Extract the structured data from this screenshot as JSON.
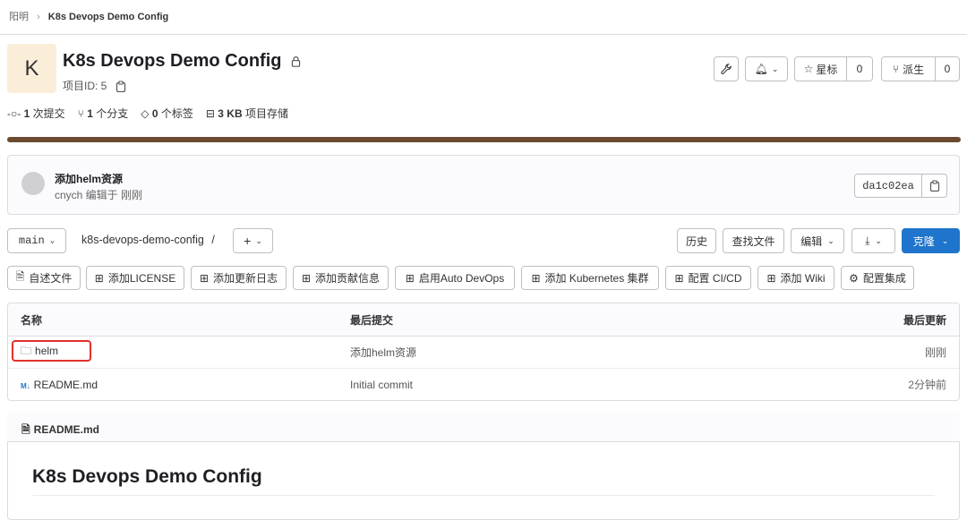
{
  "breadcrumb": {
    "parent": "阳明",
    "current": "K8s Devops Demo Config"
  },
  "project": {
    "avatar_letter": "K",
    "title": "K8s Devops Demo Config",
    "id_label": "项目ID: 5"
  },
  "header_actions": {
    "star_label": "星标",
    "star_count": "0",
    "fork_label": "派生",
    "fork_count": "0"
  },
  "stats": {
    "commits": {
      "count": "1",
      "label": "次提交"
    },
    "branches": {
      "count": "1",
      "label": "个分支"
    },
    "tags": {
      "count": "0",
      "label": "个标签"
    },
    "storage": {
      "count": "3 KB",
      "label": "项目存储"
    }
  },
  "commit": {
    "message": "添加helm资源",
    "meta": "cnych 编辑于 刚刚",
    "sha": "da1c02ea"
  },
  "repo_toolbar": {
    "branch": "main",
    "path": "k8s-devops-demo-config",
    "path_sep": "/",
    "history": "历史",
    "find_file": "查找文件",
    "edit": "编辑",
    "clone": "克隆"
  },
  "quick_buttons": [
    "自述文件",
    "添加LICENSE",
    "添加更新日志",
    "添加贡献信息",
    "启用Auto DevOps",
    "添加 Kubernetes 集群",
    "配置 CI/CD",
    "添加 Wiki",
    "配置集成"
  ],
  "file_table": {
    "headers": {
      "name": "名称",
      "last_commit": "最后提交",
      "last_update": "最后更新"
    },
    "rows": [
      {
        "name": "helm",
        "commit": "添加helm资源",
        "updated": "刚刚",
        "icon": "folder-icon"
      },
      {
        "name": "README.md",
        "commit": "Initial commit",
        "updated": "2分钟前",
        "icon": "markdown-icon"
      }
    ]
  },
  "readme": {
    "file_name": "README.md",
    "heading": "K8s Devops Demo Config"
  },
  "colors": {
    "accent": "#1f75cb",
    "progress": "#6b4a2f",
    "highlight": "#e0322b"
  }
}
